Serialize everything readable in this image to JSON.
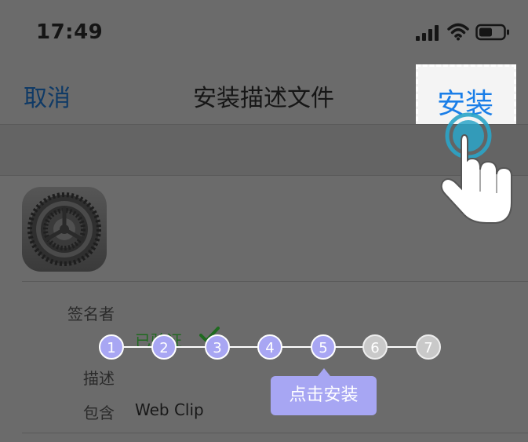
{
  "status_bar": {
    "time": "17:49"
  },
  "nav": {
    "cancel_label": "取消",
    "title": "安装描述文件",
    "install_label": "安装"
  },
  "profile": {
    "signed_by_label": "签名者",
    "signed_by_value": "已验证",
    "description_label": "描述",
    "contains_label": "包含",
    "contains_value": "Web Clip"
  },
  "guide": {
    "steps": [
      "1",
      "2",
      "3",
      "4",
      "5",
      "6",
      "7"
    ],
    "current_step": 5,
    "tooltip": "点击安装"
  },
  "colors": {
    "overlay_bg": "#6b6b6b",
    "install_blue": "#1a7ee8",
    "step_active": "#a8a6f3",
    "step_inactive": "#c9c9c9",
    "verified_green": "#1f6a1f"
  },
  "icons": {
    "signal": "signal-bars-icon",
    "wifi": "wifi-icon",
    "battery": "battery-icon",
    "app": "settings-gear-icon",
    "verified": "checkmark-icon",
    "pointer": "hand-pointer-icon"
  }
}
